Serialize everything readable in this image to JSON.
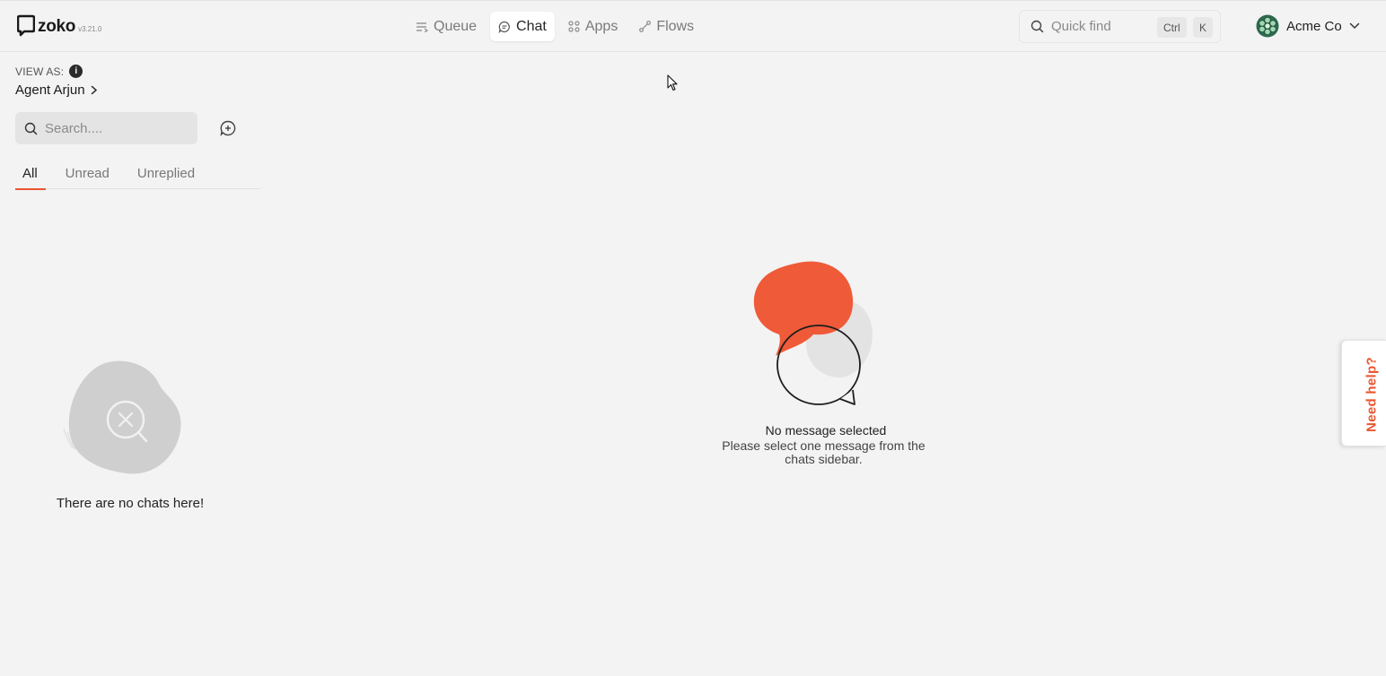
{
  "app": {
    "name": "zoko",
    "version": "v3.21.0",
    "accent_color": "#e8562f"
  },
  "nav": {
    "items": [
      {
        "label": "Queue",
        "icon": "queue-icon",
        "active": false
      },
      {
        "label": "Chat",
        "icon": "chat-icon",
        "active": true
      },
      {
        "label": "Apps",
        "icon": "apps-icon",
        "active": false
      },
      {
        "label": "Flows",
        "icon": "flows-icon",
        "active": false
      }
    ]
  },
  "quick_find": {
    "placeholder": "Quick find",
    "shortcut_keys": [
      "Ctrl",
      "K"
    ]
  },
  "account": {
    "name": "Acme Co"
  },
  "sidebar": {
    "view_as_label": "VIEW AS:",
    "agent_name": "Agent Arjun",
    "search_placeholder": "Search....",
    "tabs": [
      "All",
      "Unread",
      "Unreplied"
    ],
    "active_tab": "All",
    "empty_text": "There are no chats here!"
  },
  "main": {
    "empty_title": "No message selected",
    "empty_description": "Please select one message from the chats sidebar."
  },
  "help": {
    "label": "Need help?"
  }
}
